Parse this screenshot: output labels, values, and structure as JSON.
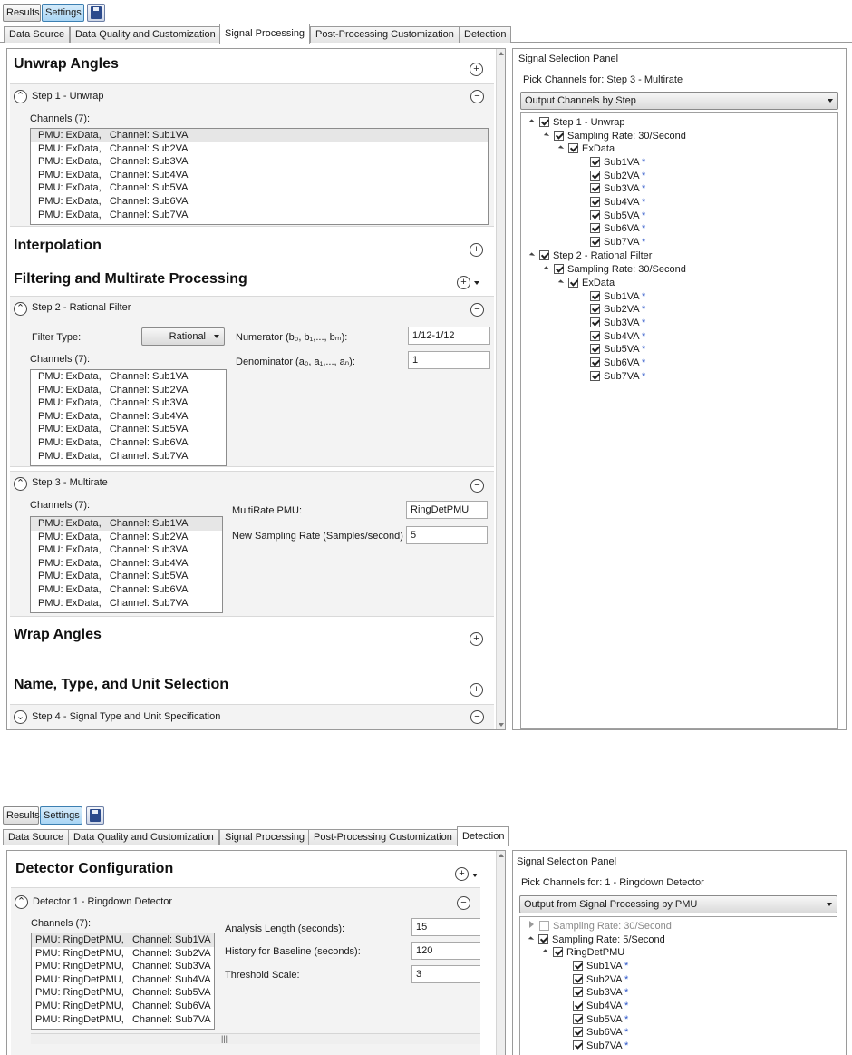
{
  "toolbar": {
    "results": "Results",
    "settings": "Settings"
  },
  "tabs": [
    "Data Source",
    "Data Quality and Customization",
    "Signal Processing",
    "Post-Processing Customization",
    "Detection"
  ],
  "screen1": {
    "unwrap": {
      "title": "Unwrap Angles",
      "step": "Step 1 - Unwrap",
      "channels_label": "Channels (7):",
      "channels": [
        "PMU: ExData,   Channel: Sub1VA",
        "PMU: ExData,   Channel: Sub2VA",
        "PMU: ExData,   Channel: Sub3VA",
        "PMU: ExData,   Channel: Sub4VA",
        "PMU: ExData,   Channel: Sub5VA",
        "PMU: ExData,   Channel: Sub6VA",
        "PMU: ExData,   Channel: Sub7VA"
      ]
    },
    "interpolation": {
      "title": "Interpolation"
    },
    "filtering": {
      "title": "Filtering and Multirate Processing",
      "step2": "Step 2 - Rational Filter",
      "filter_type_label": "Filter Type:",
      "filter_type_value": "Rational",
      "numerator_label": "Numerator (b₀, b₁,..., bₘ):",
      "numerator_value": "1/12-1/12",
      "denominator_label": "Denominator (a₀, a₁,..., aₙ):",
      "denominator_value": "1",
      "channels_label": "Channels (7):",
      "channels": [
        "PMU: ExData,   Channel: Sub1VA",
        "PMU: ExData,   Channel: Sub2VA",
        "PMU: ExData,   Channel: Sub3VA",
        "PMU: ExData,   Channel: Sub4VA",
        "PMU: ExData,   Channel: Sub5VA",
        "PMU: ExData,   Channel: Sub6VA",
        "PMU: ExData,   Channel: Sub7VA"
      ],
      "step3": "Step 3 - Multirate",
      "step3_channels_label": "Channels (7):",
      "step3_channels": [
        "PMU: ExData,   Channel: Sub1VA",
        "PMU: ExData,   Channel: Sub2VA",
        "PMU: ExData,   Channel: Sub3VA",
        "PMU: ExData,   Channel: Sub4VA",
        "PMU: ExData,   Channel: Sub5VA",
        "PMU: ExData,   Channel: Sub6VA",
        "PMU: ExData,   Channel: Sub7VA"
      ],
      "multirate_pmu_label": "MultiRate PMU:",
      "multirate_pmu_value": "RingDetPMU",
      "new_rate_label": "New Sampling Rate (Samples/second)",
      "new_rate_value": "5"
    },
    "wrap": {
      "title": "Wrap Angles"
    },
    "name_type": {
      "title": "Name, Type, and Unit Selection",
      "step4": "Step 4 - Signal Type and Unit Specification"
    },
    "panel": {
      "title": "Signal Selection Panel",
      "pick": "Pick Channels for: Step 3 - Multirate",
      "dropdown": "Output Channels by Step",
      "tree": {
        "step1": "Step 1 - Unwrap",
        "step1_rate": "Sampling Rate: 30/Second",
        "step1_pmu": "ExData",
        "step1_signals": [
          "Sub1VA",
          "Sub2VA",
          "Sub3VA",
          "Sub4VA",
          "Sub5VA",
          "Sub6VA",
          "Sub7VA"
        ],
        "step2": "Step 2 - Rational Filter",
        "step2_rate": "Sampling Rate: 30/Second",
        "step2_pmu": "ExData",
        "step2_signals": [
          "Sub1VA",
          "Sub2VA",
          "Sub3VA",
          "Sub4VA",
          "Sub5VA",
          "Sub6VA",
          "Sub7VA"
        ]
      }
    }
  },
  "screen2": {
    "title": "Detector Configuration",
    "detector": "Detector 1 - Ringdown Detector",
    "channels_label": "Channels (7):",
    "channels": [
      "PMU: RingDetPMU,   Channel: Sub1VA",
      "PMU: RingDetPMU,   Channel: Sub2VA",
      "PMU: RingDetPMU,   Channel: Sub3VA",
      "PMU: RingDetPMU,   Channel: Sub4VA",
      "PMU: RingDetPMU,   Channel: Sub5VA",
      "PMU: RingDetPMU,   Channel: Sub6VA",
      "PMU: RingDetPMU,   Channel: Sub7VA"
    ],
    "analysis_length_label": "Analysis Length (seconds):",
    "analysis_length_value": "15",
    "history_label": "History for Baseline (seconds):",
    "history_value": "120",
    "threshold_label": "Threshold Scale:",
    "threshold_value": "3",
    "panel": {
      "title": "Signal Selection Panel",
      "pick": "Pick Channels for: 1 - Ringdown Detector",
      "dropdown": "Output from Signal Processing by PMU",
      "rate_30": "Sampling Rate: 30/Second",
      "rate_5": "Sampling Rate: 5/Second",
      "pmu": "RingDetPMU",
      "signals": [
        "Sub1VA",
        "Sub2VA",
        "Sub3VA",
        "Sub4VA",
        "Sub5VA",
        "Sub6VA",
        "Sub7VA"
      ]
    }
  },
  "icons": {
    "star": "*",
    "plus": "+",
    "minus": "−",
    "chevron_up": "⌃",
    "chevron_down": "⌄"
  }
}
